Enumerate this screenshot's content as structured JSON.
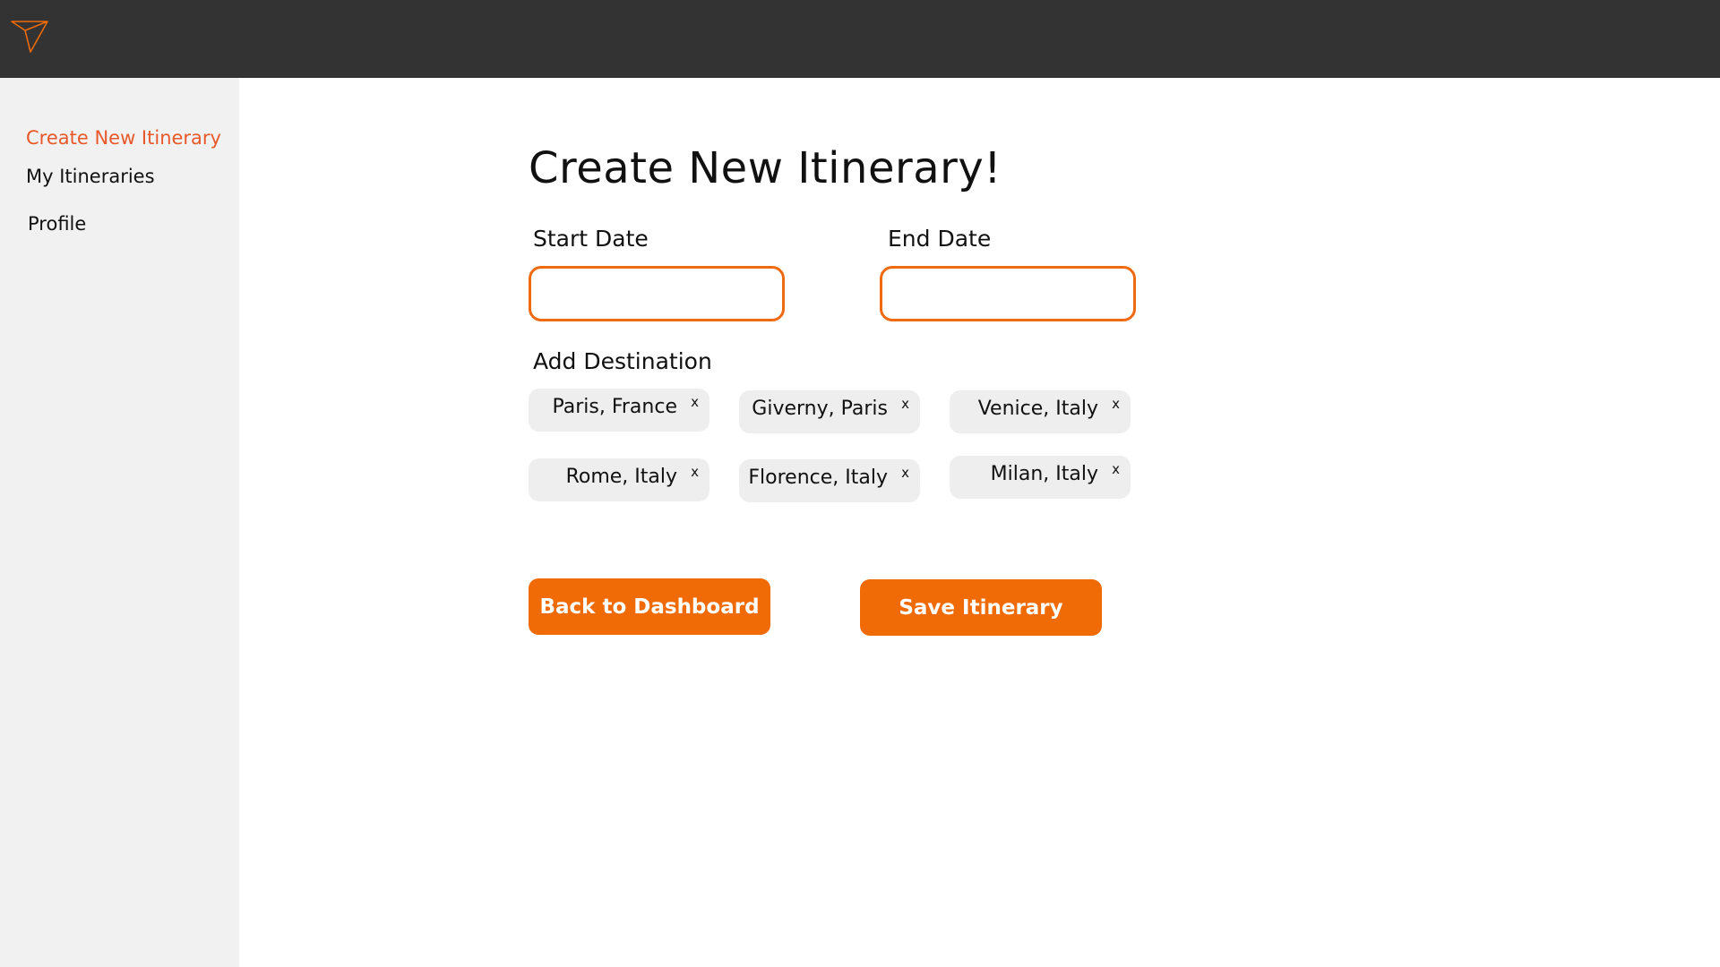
{
  "colors": {
    "topbar": "#333333",
    "sidebar": "#f1f1f1",
    "accent": "#f06a06",
    "active_nav": "#e8582a",
    "chip": "#eeeeee"
  },
  "header": {
    "logo_icon": "paper-plane-icon"
  },
  "sidebar": {
    "items": [
      {
        "label": "Create New Itinerary",
        "active": true
      },
      {
        "label": "My Itineraries",
        "active": false
      },
      {
        "label": "Profile",
        "active": false
      }
    ]
  },
  "main": {
    "title": "Create New Itinerary!",
    "start_date": {
      "label": "Start Date",
      "value": ""
    },
    "end_date": {
      "label": "End Date",
      "value": ""
    },
    "destinations_label": "Add Destination",
    "destinations": [
      "Paris, France",
      "Giverny, Paris",
      "Venice, Italy",
      "Rome, Italy",
      "Florence, Italy",
      "Milan, Italy"
    ],
    "chip_remove_symbol": "x",
    "back_button": "Back to Dashboard",
    "save_button": "Save Itinerary"
  }
}
